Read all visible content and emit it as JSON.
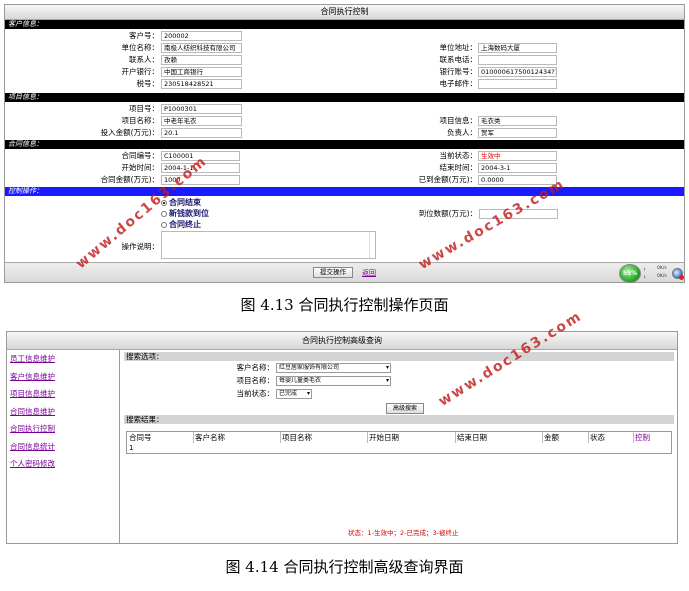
{
  "fig1": {
    "title": "合同执行控制",
    "sections": {
      "customer": "客户信息：",
      "project": "项目信息：",
      "contract": "合同信息：",
      "control": "控制操作："
    },
    "customer": {
      "id_label": "客户号：",
      "id_value": "200002",
      "unit_label": "单位名称：",
      "unit_value": "南极人纺织科技有限公司",
      "addr_label": "单位地址：",
      "addr_value": "上海数码大厦",
      "contact_label": "联系人：",
      "contact_value": "孜赖",
      "phone_label": "联系电话：",
      "phone_value": "",
      "bank_label": "开户银行：",
      "bank_value": "中国工商银行",
      "account_label": "银行账号：",
      "account_value": "01000061750012434?1",
      "tax_label": "税号：",
      "tax_value": "230518428521",
      "email_label": "电子邮件：",
      "email_value": ""
    },
    "project": {
      "id_label": "项目号：",
      "id_value": "P1000301",
      "name_label": "项目名称：",
      "name_value": "中老年毛衣",
      "info_label": "项目信息：",
      "info_value": "毛衣类",
      "amount_label": "投入金额(万元)：",
      "amount_value": "20.1",
      "owner_label": "负责人：",
      "owner_value": "贺军"
    },
    "contract": {
      "id_label": "合同编号：",
      "id_value": "C100001",
      "status_label": "当前状态：",
      "status_value": "生效中",
      "start_label": "开始时间：",
      "start_value": "2004-1-1",
      "end_label": "结束时间：",
      "end_value": "2004-3-1",
      "amount_label": "合同金额(万元)：",
      "amount_value": "1000",
      "arrived_label": "已到金额(万元)：",
      "arrived_value": "0.0000"
    },
    "control": {
      "options": [
        "合同结束",
        "新钱款到位",
        "合同终止"
      ],
      "selected_index": 0,
      "arrival_label": "到位数额(万元)：",
      "arrival_value": "",
      "desc_label": "操作说明："
    },
    "submit_label": "提交操作",
    "back_label": "返回",
    "widget": {
      "percent": "55%",
      "speed_up": "0K/s",
      "speed_down": "0K/s"
    },
    "caption": "图 4.13  合同执行控制操作页面"
  },
  "fig2": {
    "title": "合同执行控制高级查询",
    "sidebar": [
      "员工信息维护",
      "客户信息维护",
      "项目信息维护",
      "合同信息维护",
      "合同执行控制",
      "合同信息统计",
      "个人密码修改"
    ],
    "search_head": "搜索选项：",
    "customer_label": "客户名称：",
    "customer_value": "红豆居家服饰有限公司",
    "project_label": "项目名称：",
    "project_value": "毎婴儿童类毛衣",
    "status_label": "当前状态：",
    "status_value": "已完成",
    "adv_button": "高级搜索",
    "result_head": "搜索结果：",
    "columns": [
      "合同号",
      "客户名称",
      "项目名称",
      "开始日期",
      "结束日期",
      "金额",
      "状态",
      "控制"
    ],
    "row_value": "1",
    "status_note": "状态：1-生效中；2-已完成；3-被终止",
    "caption": "图 4.14  合同执行控制高级查询界面"
  },
  "watermarks": [
    "www.doc163.com",
    "www.doc163.com",
    "www.doc163.com"
  ],
  "colors": {
    "section_black": "#000000",
    "section_blue": "#1a1aff",
    "link_purple": "#7a0099",
    "status_red": "#e00000",
    "watermark_red": "#c21a1a"
  }
}
